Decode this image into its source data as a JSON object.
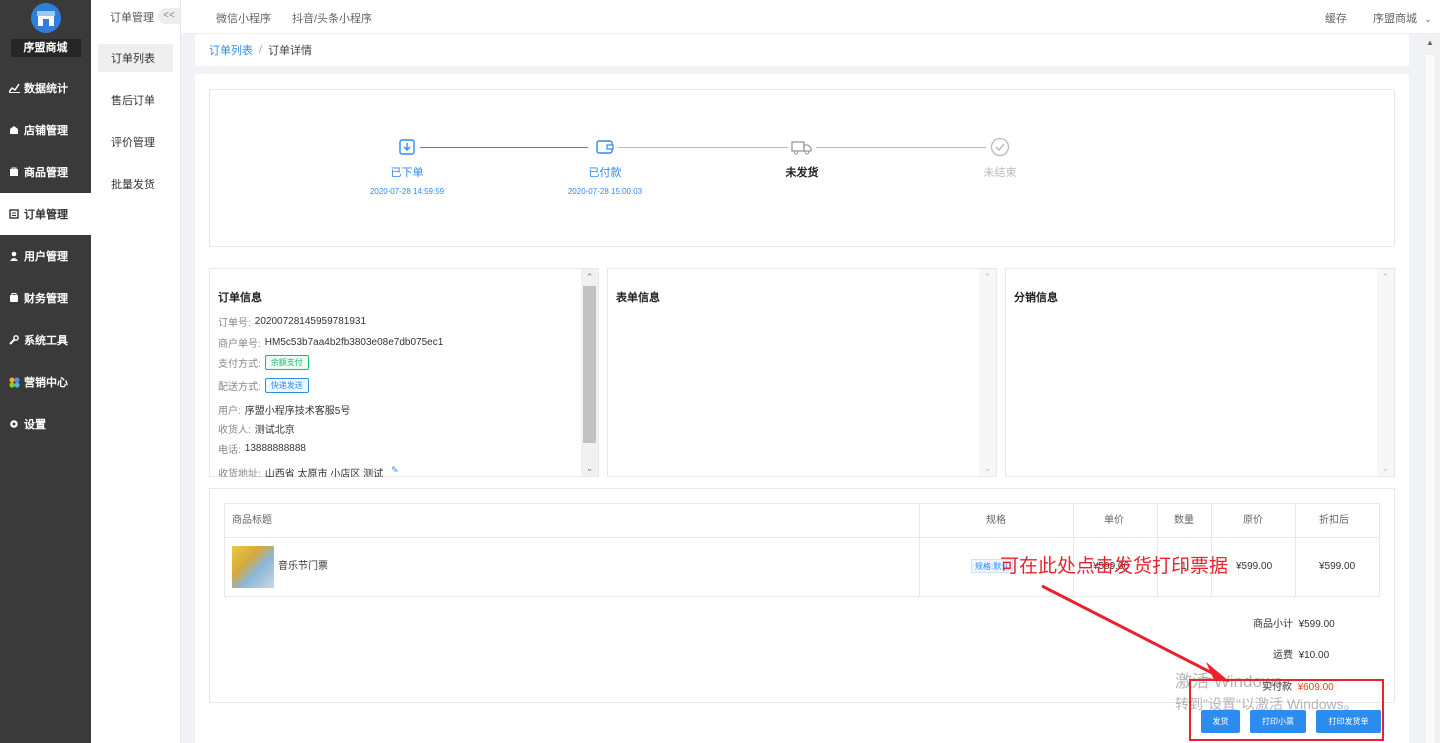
{
  "sidebar": {
    "brand": "序盟商城",
    "items": [
      {
        "label": "数据统计",
        "icon": "chart-icon"
      },
      {
        "label": "店铺管理",
        "icon": "shop-icon"
      },
      {
        "label": "商品管理",
        "icon": "goods-icon"
      },
      {
        "label": "订单管理",
        "icon": "order-icon"
      },
      {
        "label": "用户管理",
        "icon": "user-icon"
      },
      {
        "label": "财务管理",
        "icon": "finance-icon"
      },
      {
        "label": "系统工具",
        "icon": "wrench-icon"
      },
      {
        "label": "营销中心",
        "icon": "marketing-icon"
      },
      {
        "label": "设置",
        "icon": "gear-icon"
      }
    ]
  },
  "submenu": {
    "title": "订单管理",
    "collapse": "<<",
    "items": [
      "订单列表",
      "售后订单",
      "评价管理",
      "批量发货"
    ]
  },
  "topbar": {
    "tabs": [
      "微信小程序",
      "抖音/头条小程序"
    ],
    "cache": "缓存",
    "user": "序盟商城"
  },
  "breadcrumb": {
    "parent": "订单列表",
    "sep": "/",
    "current": "订单详情"
  },
  "steps": [
    {
      "label": "已下单",
      "time": "2020-07-28 14:59:59"
    },
    {
      "label": "已付款",
      "time": "2020-07-28 15:00:03"
    },
    {
      "label": "未发货",
      "time": ""
    },
    {
      "label": "未结束",
      "time": ""
    }
  ],
  "order_info": {
    "title": "订单信息",
    "order_no_label": "订单号:",
    "order_no": "20200728145959781931",
    "merchant_no_label": "商户单号:",
    "merchant_no": "HM5c53b7aa4b2fb3803e08e7db075ec1",
    "pay_label": "支付方式:",
    "pay": "余额支付",
    "delivery_label": "配送方式:",
    "delivery": "快递发送",
    "user_label": "用户:",
    "user": "序盟小程序技术客服5号",
    "receiver_label": "收货人:",
    "receiver": "测试北京",
    "phone_label": "电话:",
    "phone": "13888888888",
    "address_label": "收货地址:",
    "address": "山西省 太原市 小店区 测试"
  },
  "form_info": {
    "title": "表单信息"
  },
  "dist_info": {
    "title": "分销信息"
  },
  "goods_table": {
    "headers": [
      "商品标题",
      "规格",
      "单价",
      "数量",
      "原价",
      "折扣后"
    ],
    "rows": [
      {
        "title": "音乐节门票",
        "spec": "规格:默认",
        "price": "¥599.00",
        "qty": "1",
        "orig": "¥599.00",
        "discounted": "¥599.00"
      }
    ]
  },
  "summary": {
    "subtotal_label": "商品小计",
    "subtotal": "¥599.00",
    "freight_label": "运费",
    "freight": "¥10.00",
    "paid_label": "实付款",
    "paid": "¥609.00"
  },
  "buttons": {
    "ship": "发货",
    "print_receipt": "打印小票",
    "print_delivery": "打印发货单"
  },
  "annotation": "可在此处点击发货打印票据",
  "watermark": {
    "line1": "激活 Windows",
    "line2": "转到\"设置\"以激活 Windows。"
  },
  "colors": {
    "accent": "#2d8cf0",
    "sidebar": "#3a3a3a",
    "annotation": "#e8222e",
    "success": "#19be6b"
  }
}
